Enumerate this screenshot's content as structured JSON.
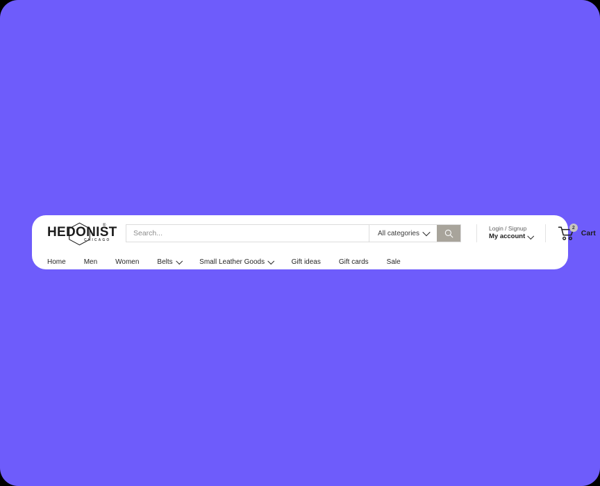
{
  "theme": {
    "page_background": "#6E5CFB",
    "card_background": "#FFFFFF",
    "search_button_background": "#A8A49B",
    "badge_background": "#C9C6C1",
    "text_primary": "#1C1C1C",
    "text_muted": "#5D5D5D",
    "border": "#DCDCDC"
  },
  "logo": {
    "wordmark": "HEDONIST",
    "registered_mark": "®",
    "tagline": "CHICAGO",
    "shape_icon": "hexagon-icon"
  },
  "search": {
    "placeholder": "Search...",
    "value": "",
    "category_label": "All categories",
    "category_chevron_icon": "chevron-down-icon",
    "submit_icon": "search-icon"
  },
  "account": {
    "login_label": "Login / Signup",
    "account_label": "My account",
    "chevron_icon": "chevron-down-icon"
  },
  "cart": {
    "label": "Cart",
    "count": "2",
    "icon": "shopping-cart-icon"
  },
  "nav": {
    "items": [
      {
        "label": "Home",
        "has_dropdown": false
      },
      {
        "label": "Men",
        "has_dropdown": false
      },
      {
        "label": "Women",
        "has_dropdown": false
      },
      {
        "label": "Belts",
        "has_dropdown": true
      },
      {
        "label": "Small Leather Goods",
        "has_dropdown": true
      },
      {
        "label": "Gift ideas",
        "has_dropdown": false
      },
      {
        "label": "Gift cards",
        "has_dropdown": false
      },
      {
        "label": "Sale",
        "has_dropdown": false
      }
    ]
  }
}
